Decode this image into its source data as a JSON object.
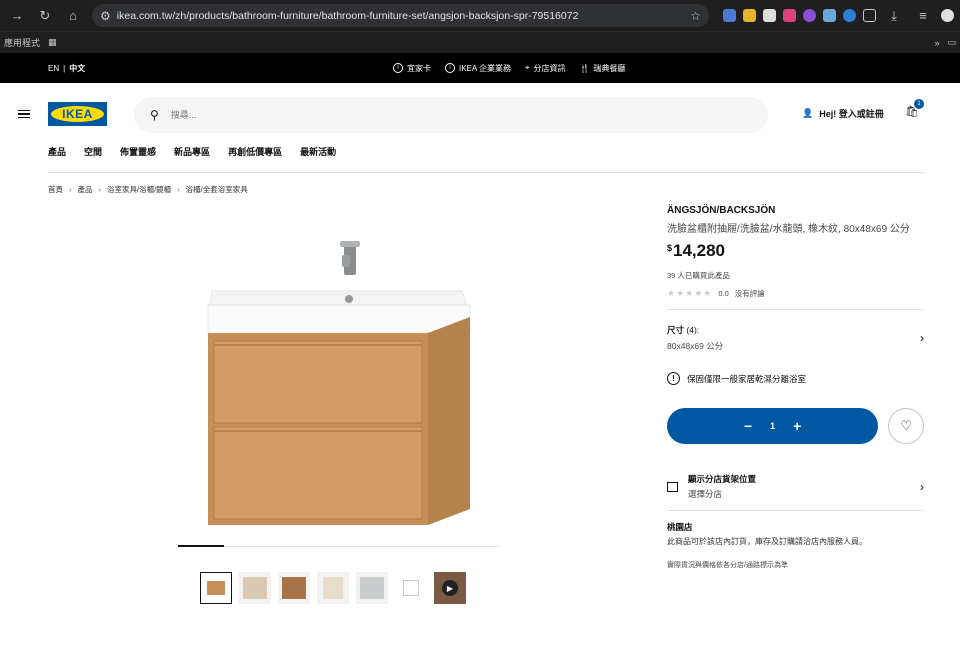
{
  "browser": {
    "url": "ikea.com.tw/zh/products/bathroom-furniture/bathroom-furniture-set/angsjon-backsjon-spr-79516072",
    "bookmark_label": "應用程式",
    "bookmark_overflow": "»"
  },
  "topbar": {
    "lang_en": "EN",
    "lang_zh": "中文",
    "links": [
      "宜家卡",
      "IKEA 企業業務",
      "分店資訊",
      "瑞典餐廳"
    ]
  },
  "header": {
    "logo": "IKEA",
    "search_placeholder": "搜尋...",
    "login": "Hej! 登入或註冊",
    "cart_count": "1"
  },
  "nav": [
    "產品",
    "空間",
    "佈置靈感",
    "新品專區",
    "再創低價專區",
    "最新活動"
  ],
  "breadcrumb": [
    "首頁",
    "產品",
    "浴室家具/浴櫃/鏡櫃",
    "浴櫃/全套浴室家具"
  ],
  "product": {
    "name": "ÄNGSJÖN/BACKSJÖN",
    "description": "洗臉盆櫃附抽屜/洗臉盆/水龍頭, 橡木紋, 80x48x69 公分",
    "currency": "$",
    "price": "14,280",
    "bought": "39 人已購買此產品",
    "rating_value": "0.0",
    "rating_text": "沒有評論",
    "size_label": "尺寸",
    "size_count": "(4):",
    "size_value": "80x48x69 公分",
    "warning": "保固僅限一般家居乾濕分離浴室",
    "quantity": "1",
    "store_title": "顯示分店貨架位置",
    "store_sub": "選擇分店",
    "store_name": "桃園店",
    "store_note": "此商品可於該店內訂貨，庫存及訂購請洽店內服務人員。",
    "disclaimer": "實際貨況與價格依各分店/通路標示為準"
  },
  "colors": {
    "ikea_blue": "#0058a3",
    "ikea_yellow": "#ffdb00",
    "wood": "#c8955a"
  }
}
